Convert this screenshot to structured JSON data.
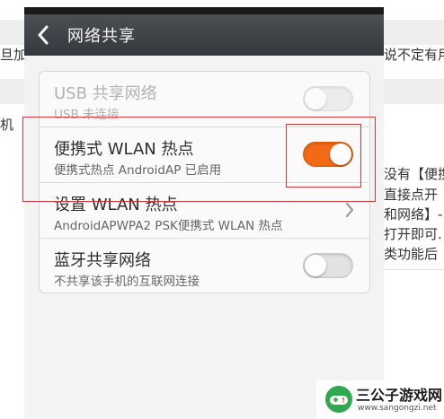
{
  "background": {
    "left_fragments": [
      "旦加",
      "机"
    ],
    "right_fragments": [
      "说不定有用",
      "没有【便携",
      "直接点开",
      "和网络】-",
      "打开即可.",
      "类功能后"
    ]
  },
  "header": {
    "title": "网络共享",
    "back_icon": "chevron-left-icon"
  },
  "rows": [
    {
      "title": "USB 共享网络",
      "subtitle": "USB 未连接",
      "control": "toggle",
      "state": "off",
      "enabled": false
    },
    {
      "title": "便携式 WLAN 热点",
      "subtitle": "便携式热点 AndroidAP 已启用",
      "control": "toggle",
      "state": "on",
      "enabled": true
    },
    {
      "title": "设置 WLAN 热点",
      "subtitle": "AndroidAPWPA2 PSK便携式 WLAN 热点",
      "control": "chevron",
      "enabled": true
    },
    {
      "title": "蓝牙共享网络",
      "subtitle": "不共享该手机的互联网连接",
      "control": "toggle",
      "state": "off",
      "enabled": true
    }
  ],
  "colors": {
    "accent": "#f26a16",
    "header": "#3f4347",
    "annotation": "#c8383a"
  },
  "watermark": {
    "name": "三公子游戏网",
    "url": "www.sangongzi.net"
  }
}
